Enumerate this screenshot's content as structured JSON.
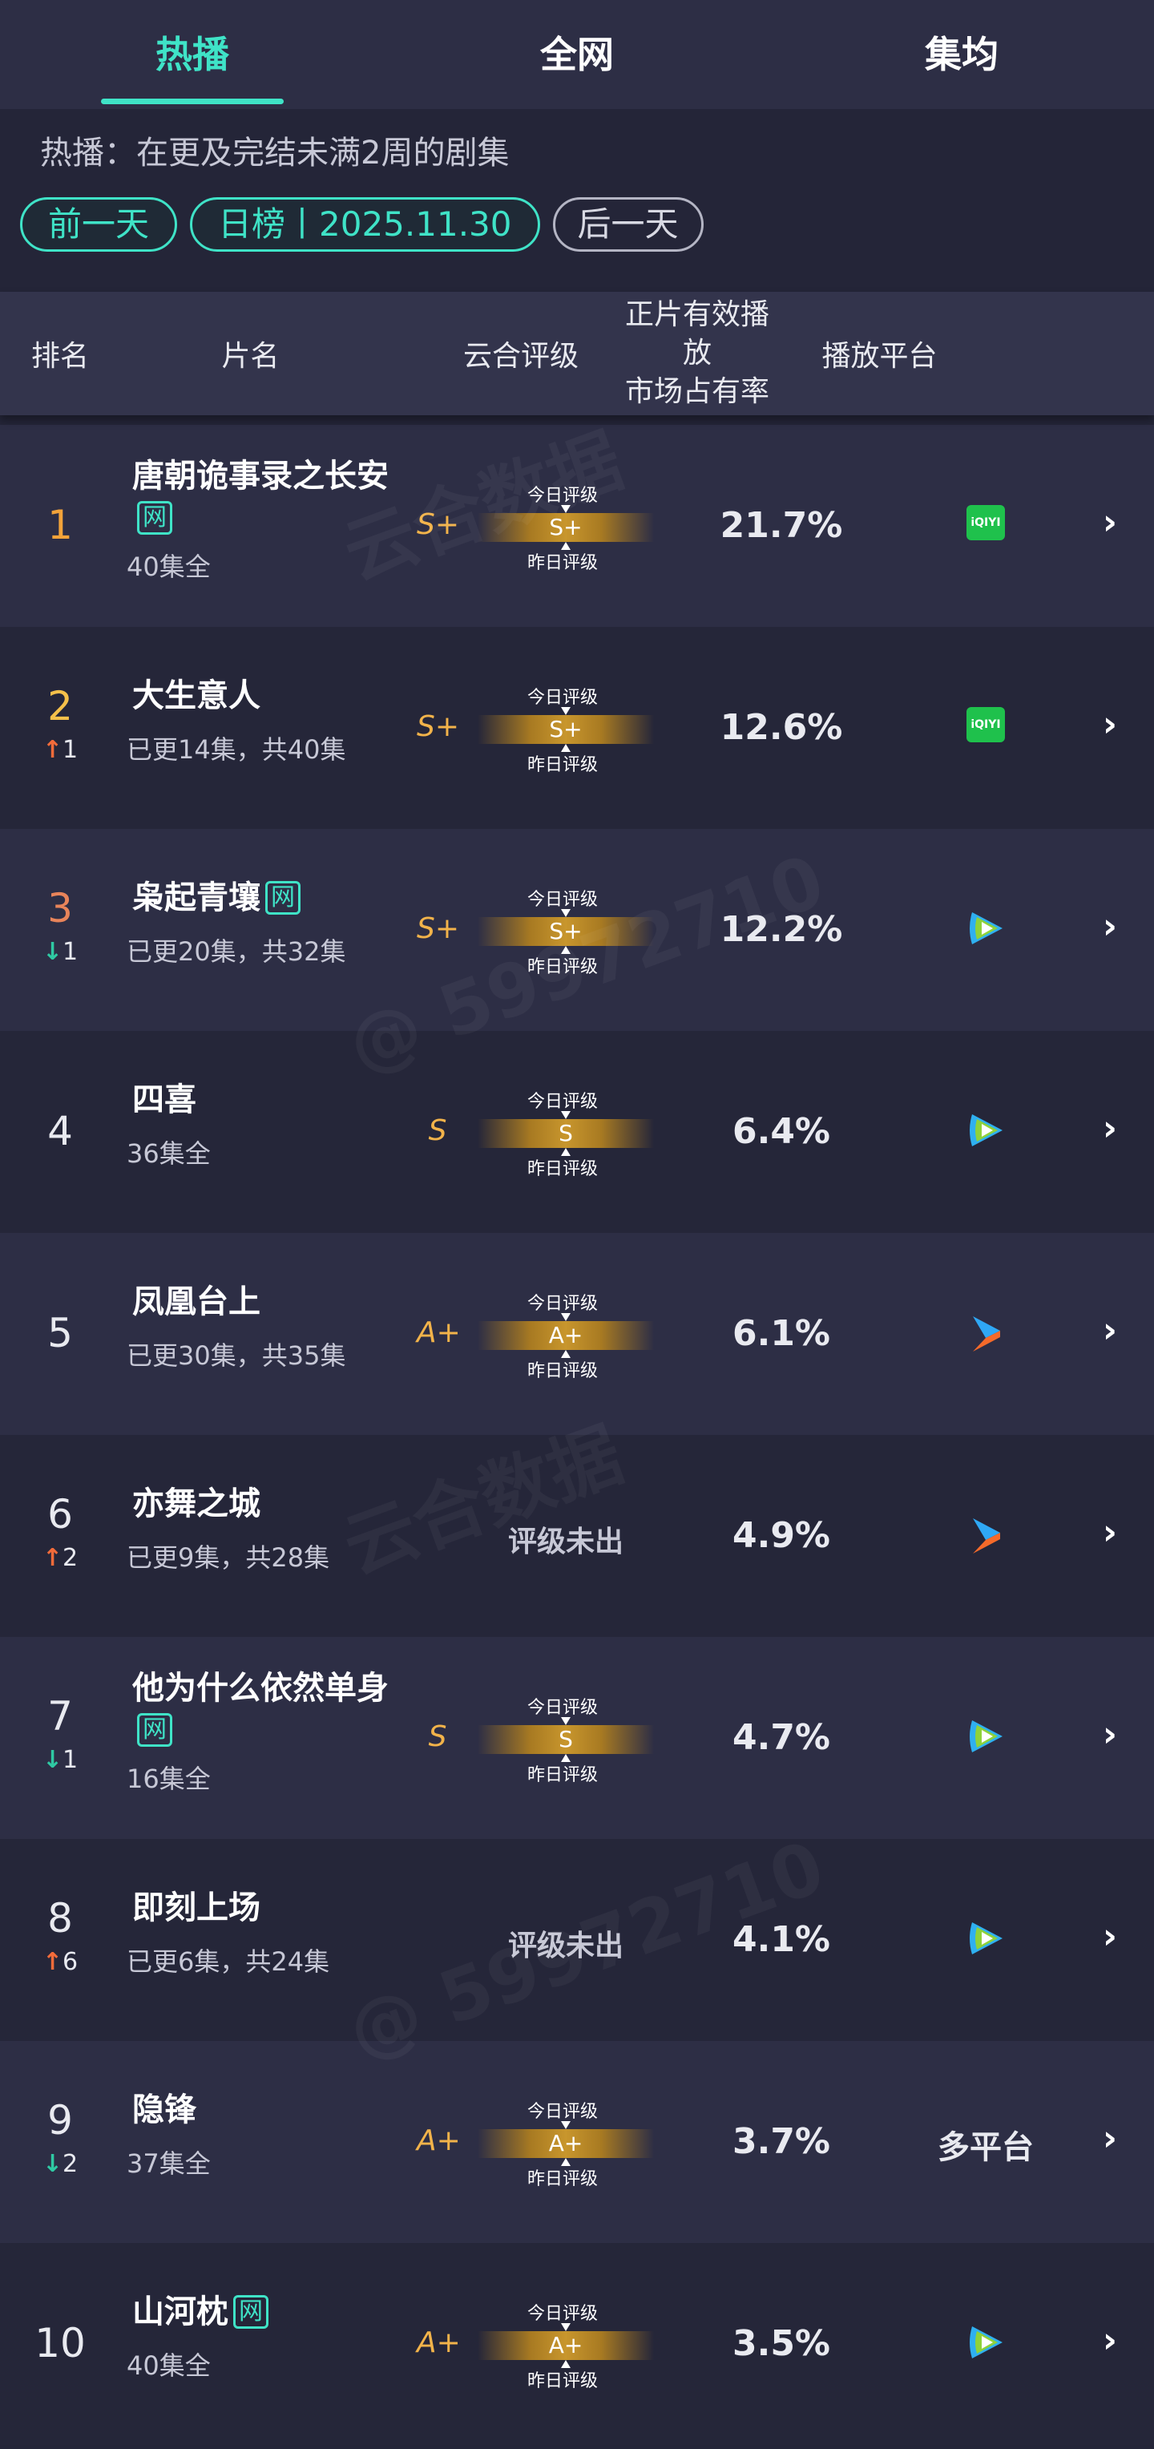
{
  "tabs": [
    "热播",
    "全网",
    "集均"
  ],
  "subtitle": "热播：在更及完结未满2周的剧集",
  "date": {
    "prev": "前一天",
    "current": "日榜丨2025.11.30",
    "next": "后一天"
  },
  "headers": {
    "rank": "排名",
    "title": "片名",
    "rating": "云合评级",
    "share_line1": "正片有效播放",
    "share_line2": "市场占有率",
    "platform": "播放平台"
  },
  "labels": {
    "today": "今日评级",
    "yesterday": "昨日评级",
    "pending": "评级未出",
    "net": "网",
    "multi": "多平台"
  },
  "watermarks": [
    "云合数据",
    "@ 59972710"
  ],
  "rows": [
    {
      "rank": "1",
      "title": "唐朝诡事录之长安",
      "net": true,
      "episodes": "40集全",
      "change": "",
      "change_dir": "none",
      "grade": "S+",
      "share": "21.7%",
      "platform": "iqiyi"
    },
    {
      "rank": "2",
      "title": "大生意人",
      "net": false,
      "episodes": "已更14集，共40集",
      "change": "1",
      "change_dir": "up",
      "grade": "S+",
      "share": "12.6%",
      "platform": "iqiyi"
    },
    {
      "rank": "3",
      "title": "枭起青壤",
      "net": true,
      "episodes": "已更20集，共32集",
      "change": "1",
      "change_dir": "down",
      "grade": "S+",
      "share": "12.2%",
      "platform": "tencent"
    },
    {
      "rank": "4",
      "title": "四喜",
      "net": false,
      "episodes": "36集全",
      "change": "",
      "change_dir": "none",
      "grade": "S",
      "share": "6.4%",
      "platform": "tencent"
    },
    {
      "rank": "5",
      "title": "凤凰台上",
      "net": false,
      "episodes": "已更30集，共35集",
      "change": "",
      "change_dir": "none",
      "grade": "A+",
      "share": "6.1%",
      "platform": "youku"
    },
    {
      "rank": "6",
      "title": "亦舞之城",
      "net": false,
      "episodes": "已更9集，共28集",
      "change": "2",
      "change_dir": "up",
      "grade": "",
      "share": "4.9%",
      "platform": "youku"
    },
    {
      "rank": "7",
      "title": "他为什么依然单身",
      "net": true,
      "episodes": "16集全",
      "change": "1",
      "change_dir": "down",
      "grade": "S",
      "share": "4.7%",
      "platform": "tencent"
    },
    {
      "rank": "8",
      "title": "即刻上场",
      "net": false,
      "episodes": "已更6集，共24集",
      "change": "6",
      "change_dir": "up",
      "grade": "",
      "share": "4.1%",
      "platform": "tencent"
    },
    {
      "rank": "9",
      "title": "隐锋",
      "net": false,
      "episodes": "37集全",
      "change": "2",
      "change_dir": "down",
      "grade": "A+",
      "share": "3.7%",
      "platform": "multi"
    },
    {
      "rank": "10",
      "title": "山河枕",
      "net": true,
      "episodes": "40集全",
      "change": "",
      "change_dir": "none",
      "grade": "A+",
      "share": "3.5%",
      "platform": "tencent"
    }
  ],
  "colors": {
    "accent": "#3fe3c7",
    "gold": "#f2b34a",
    "up": "#f26b3a",
    "down": "#2fc9a3",
    "rank1": "#f2a33a",
    "rank2": "#f5c04a",
    "rank3": "#e8845a",
    "iqiyi": "#1fc14c"
  }
}
